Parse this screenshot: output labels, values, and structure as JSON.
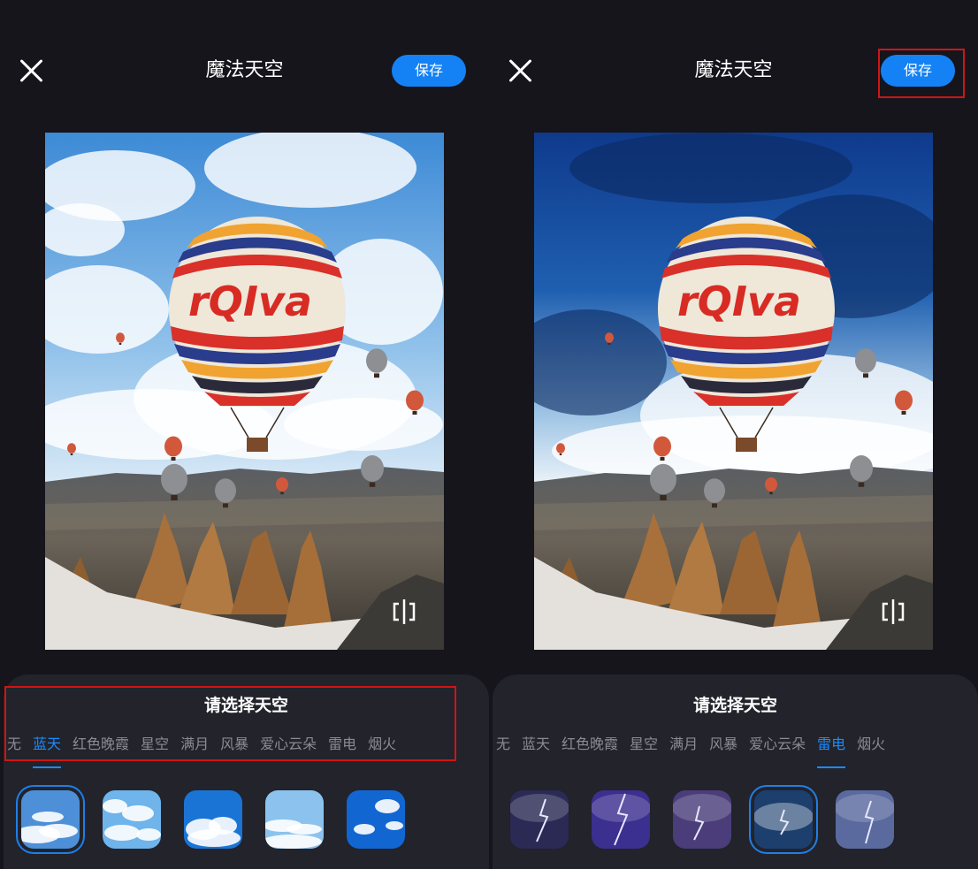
{
  "left": {
    "title": "魔法天空",
    "save_label": "保存",
    "sheet_title": "请选择天空",
    "tabs": [
      "无",
      "蓝天",
      "红色晚霞",
      "星空",
      "满月",
      "风暴",
      "爱心云朵",
      "雷电",
      "烟火"
    ],
    "active_tab": 1,
    "thumb_set": "blue-sky",
    "selected_thumb": 0,
    "photo_text": "rQIva",
    "sky": "blue"
  },
  "right": {
    "title": "魔法天空",
    "save_label": "保存",
    "sheet_title": "请选择天空",
    "tabs": [
      "无",
      "蓝天",
      "红色晚霞",
      "星空",
      "满月",
      "风暴",
      "爱心云朵",
      "雷电",
      "烟火"
    ],
    "active_tab": 7,
    "thumb_set": "lightning",
    "selected_thumb": 3,
    "photo_text": "rQIva",
    "sky": "storm"
  },
  "colors": {
    "accent": "#1a8cff",
    "save_button": "#1482f5",
    "highlight": "#d01515",
    "background": "#16151c"
  },
  "icons": {
    "close": "close-icon",
    "compare": "compare-icon"
  }
}
